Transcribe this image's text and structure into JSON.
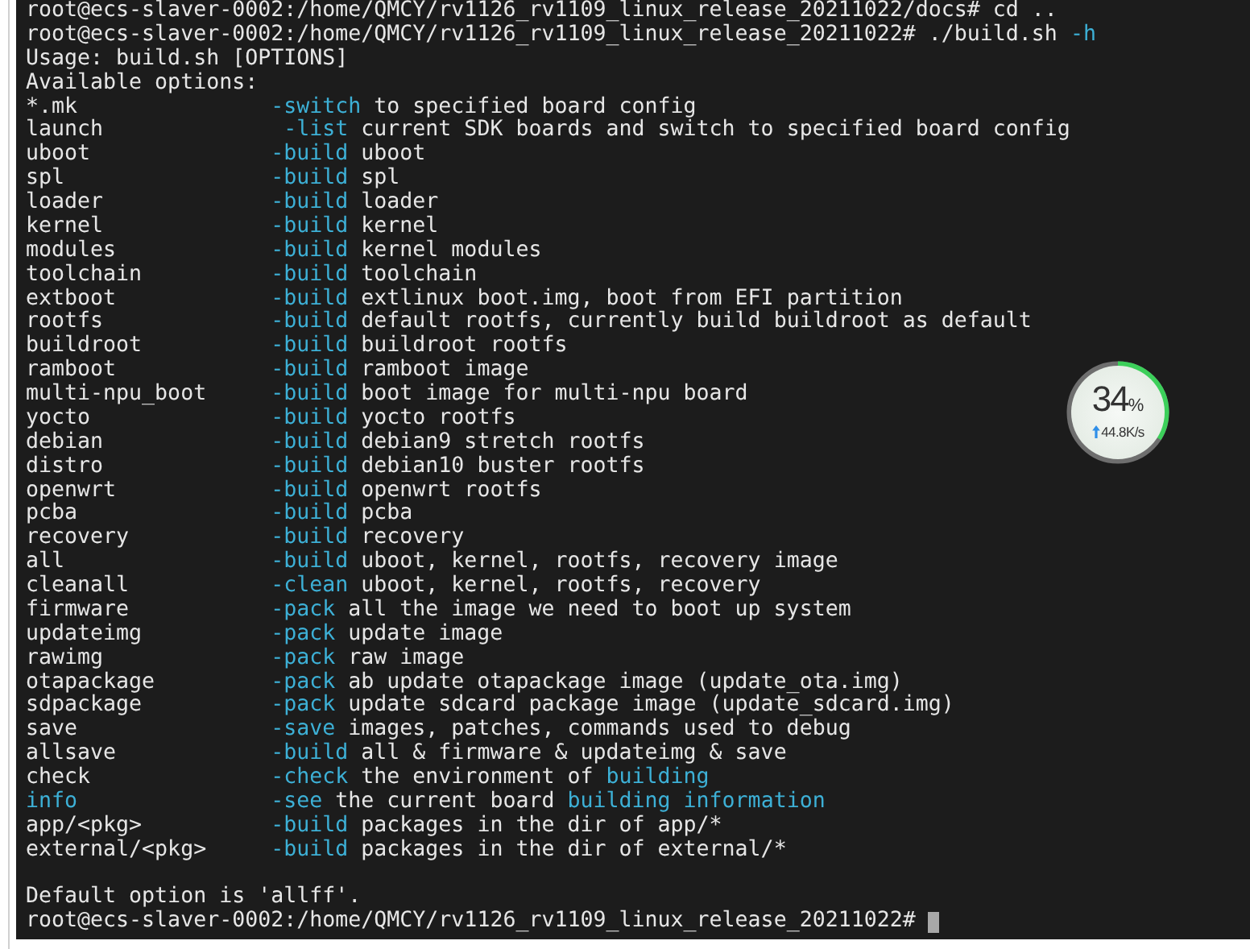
{
  "terminal": {
    "lines": [
      {
        "kind": "text",
        "segments": [
          {
            "text": "root@ecs-slaver-0002:/home/QMCY/rv1126_rv1109_linux_release_20211022/docs# cd ..",
            "highlight": false
          }
        ]
      },
      {
        "kind": "text",
        "segments": [
          {
            "text": "root@ecs-slaver-0002:/home/QMCY/rv1126_rv1109_linux_release_20211022# ./build.sh ",
            "highlight": false
          },
          {
            "text": "-h",
            "highlight": true
          }
        ]
      },
      {
        "kind": "text",
        "segments": [
          {
            "text": "Usage: build.sh [OPTIONS]",
            "highlight": false
          }
        ]
      },
      {
        "kind": "text",
        "segments": [
          {
            "text": "Available options:",
            "highlight": false
          }
        ]
      },
      {
        "kind": "option",
        "name": "*.mk",
        "highlighted": false,
        "flag": "-switch",
        "description": [
          {
            "text": "to specified board config",
            "highlight": false
          }
        ]
      },
      {
        "kind": "option",
        "name": "launch",
        "highlighted": false,
        "flag": " -list",
        "description": [
          {
            "text": "current SDK boards and switch to specified board config",
            "highlight": false
          }
        ]
      },
      {
        "kind": "option",
        "name": "uboot",
        "highlighted": false,
        "flag": "-build",
        "description": [
          {
            "text": "uboot",
            "highlight": false
          }
        ]
      },
      {
        "kind": "option",
        "name": "spl",
        "highlighted": false,
        "flag": "-build",
        "description": [
          {
            "text": "spl",
            "highlight": false
          }
        ]
      },
      {
        "kind": "option",
        "name": "loader",
        "highlighted": false,
        "flag": "-build",
        "description": [
          {
            "text": "loader",
            "highlight": false
          }
        ]
      },
      {
        "kind": "option",
        "name": "kernel",
        "highlighted": false,
        "flag": "-build",
        "description": [
          {
            "text": "kernel",
            "highlight": false
          }
        ]
      },
      {
        "kind": "option",
        "name": "modules",
        "highlighted": false,
        "flag": "-build",
        "description": [
          {
            "text": "kernel modules",
            "highlight": false
          }
        ]
      },
      {
        "kind": "option",
        "name": "toolchain",
        "highlighted": false,
        "flag": "-build",
        "description": [
          {
            "text": "toolchain",
            "highlight": false
          }
        ]
      },
      {
        "kind": "option",
        "name": "extboot",
        "highlighted": false,
        "flag": "-build",
        "description": [
          {
            "text": "extlinux boot.img, boot from EFI partition",
            "highlight": false
          }
        ]
      },
      {
        "kind": "option",
        "name": "rootfs",
        "highlighted": false,
        "flag": "-build",
        "description": [
          {
            "text": "default rootfs, currently build buildroot as default",
            "highlight": false
          }
        ]
      },
      {
        "kind": "option",
        "name": "buildroot",
        "highlighted": false,
        "flag": "-build",
        "description": [
          {
            "text": "buildroot rootfs",
            "highlight": false
          }
        ]
      },
      {
        "kind": "option",
        "name": "ramboot",
        "highlighted": false,
        "flag": "-build",
        "description": [
          {
            "text": "ramboot image",
            "highlight": false
          }
        ]
      },
      {
        "kind": "option",
        "name": "multi-npu_boot",
        "highlighted": false,
        "flag": "-build",
        "description": [
          {
            "text": "boot image for multi-npu board",
            "highlight": false
          }
        ]
      },
      {
        "kind": "option",
        "name": "yocto",
        "highlighted": false,
        "flag": "-build",
        "description": [
          {
            "text": "yocto rootfs",
            "highlight": false
          }
        ]
      },
      {
        "kind": "option",
        "name": "debian",
        "highlighted": false,
        "flag": "-build",
        "description": [
          {
            "text": "debian9 stretch rootfs",
            "highlight": false
          }
        ]
      },
      {
        "kind": "option",
        "name": "distro",
        "highlighted": false,
        "flag": "-build",
        "description": [
          {
            "text": "debian10 buster rootfs",
            "highlight": false
          }
        ]
      },
      {
        "kind": "option",
        "name": "openwrt",
        "highlighted": false,
        "flag": "-build",
        "description": [
          {
            "text": "openwrt rootfs",
            "highlight": false
          }
        ]
      },
      {
        "kind": "option",
        "name": "pcba",
        "highlighted": false,
        "flag": "-build",
        "description": [
          {
            "text": "pcba",
            "highlight": false
          }
        ]
      },
      {
        "kind": "option",
        "name": "recovery",
        "highlighted": false,
        "flag": "-build",
        "description": [
          {
            "text": "recovery",
            "highlight": false
          }
        ]
      },
      {
        "kind": "option",
        "name": "all",
        "highlighted": false,
        "flag": "-build",
        "description": [
          {
            "text": "uboot, kernel, rootfs, recovery image",
            "highlight": false
          }
        ]
      },
      {
        "kind": "option",
        "name": "cleanall",
        "highlighted": false,
        "flag": "-clean",
        "description": [
          {
            "text": "uboot, kernel, rootfs, recovery",
            "highlight": false
          }
        ]
      },
      {
        "kind": "option",
        "name": "firmware",
        "highlighted": false,
        "flag": "-pack",
        "description": [
          {
            "text": "all the image we need to boot up system",
            "highlight": false
          }
        ]
      },
      {
        "kind": "option",
        "name": "updateimg",
        "highlighted": false,
        "flag": "-pack",
        "description": [
          {
            "text": "update image",
            "highlight": false
          }
        ]
      },
      {
        "kind": "option",
        "name": "rawimg",
        "highlighted": false,
        "flag": "-pack",
        "description": [
          {
            "text": "raw image",
            "highlight": false
          }
        ]
      },
      {
        "kind": "option",
        "name": "otapackage",
        "highlighted": false,
        "flag": "-pack",
        "description": [
          {
            "text": "ab update otapackage image (update_ota.img)",
            "highlight": false
          }
        ]
      },
      {
        "kind": "option",
        "name": "sdpackage",
        "highlighted": false,
        "flag": "-pack",
        "description": [
          {
            "text": "update sdcard package image (update_sdcard.img)",
            "highlight": false
          }
        ]
      },
      {
        "kind": "option",
        "name": "save",
        "highlighted": false,
        "flag": "-save",
        "description": [
          {
            "text": "images, patches, commands used to debug",
            "highlight": false
          }
        ]
      },
      {
        "kind": "option",
        "name": "allsave",
        "highlighted": false,
        "flag": "-build",
        "description": [
          {
            "text": "all & firmware & updateimg & save",
            "highlight": false
          }
        ]
      },
      {
        "kind": "option",
        "name": "check",
        "highlighted": false,
        "flag": "-check",
        "description": [
          {
            "text": "the environment of ",
            "highlight": false
          },
          {
            "text": "building",
            "highlight": true
          }
        ]
      },
      {
        "kind": "option",
        "name": "info",
        "highlighted": true,
        "flag": "-see",
        "description": [
          {
            "text": "the current board ",
            "highlight": false
          },
          {
            "text": "building information",
            "highlight": true
          }
        ]
      },
      {
        "kind": "option",
        "name": "app/<pkg>",
        "highlighted": false,
        "flag": "-build",
        "description": [
          {
            "text": "packages in the dir of app/*",
            "highlight": false
          }
        ]
      },
      {
        "kind": "option",
        "name": "external/<pkg>",
        "highlighted": false,
        "flag": "-build",
        "description": [
          {
            "text": "packages in the dir of external/*",
            "highlight": false
          }
        ]
      },
      {
        "kind": "blank"
      },
      {
        "kind": "text",
        "segments": [
          {
            "text": "Default option is 'allff'.",
            "highlight": false
          }
        ]
      },
      {
        "kind": "prompt",
        "segments": [
          {
            "text": "root@ecs-slaver-0002:/home/QMCY/rv1126_rv1109_linux_release_20211022#",
            "highlight": false
          }
        ]
      }
    ]
  },
  "speed_ball": {
    "percent": "34",
    "unit": "%",
    "level": 0.34,
    "speed": "44.8K/s"
  }
}
